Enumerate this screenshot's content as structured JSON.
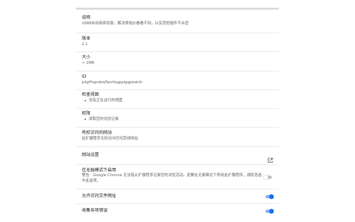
{
  "colors": {
    "accent": "#1a73e8",
    "divider": "#e8eaed",
    "secondary_text": "#5f6368"
  },
  "details": {
    "description": {
      "title": "说明",
      "value": "1688自动商拼旧版，解决原始价格看不到，以及其他插件不合适"
    },
    "version": {
      "title": "版本",
      "value": "2.1"
    },
    "size": {
      "title": "大小",
      "value": "< 1MB"
    },
    "id": {
      "title": "ID",
      "value": "pilgffhgodeijflpohbgpplggpbahih"
    },
    "views": {
      "title": "检查视图",
      "items": [
        "没有正在运行的视图"
      ]
    },
    "permissions": {
      "title": "权限",
      "items": [
        "读取您的浏览记录"
      ]
    },
    "site_access": {
      "title": "有权访问的网站",
      "value": "此扩展程序无权访问任何其他网站"
    },
    "site_settings": {
      "label": "网站设置",
      "icon": "open-in-new-icon"
    },
    "incognito": {
      "title": "在无痕模式下启用",
      "warning": "警告：Google Chrome 无法阻止扩展程序记录您的浏览活动。若要在无痕模式下停用此扩展程序，请取消选中此选项。",
      "enabled": false
    },
    "file_urls": {
      "label": "允许访问文件网址",
      "enabled": true
    },
    "collect_errors": {
      "label": "收集各项错误",
      "enabled": true
    }
  }
}
